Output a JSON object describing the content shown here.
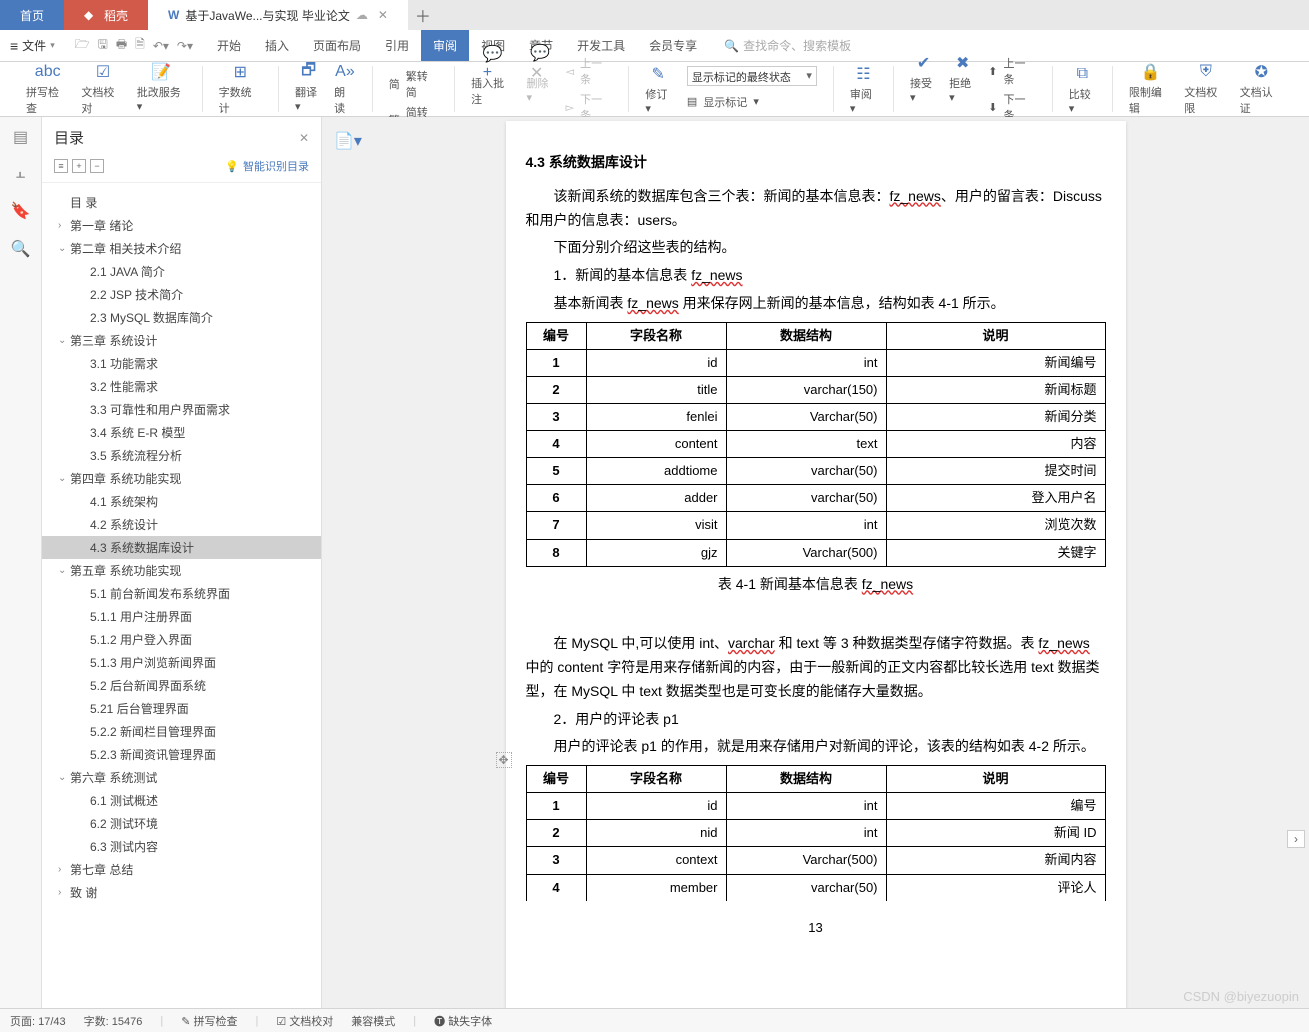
{
  "tabs": {
    "home": "首页",
    "doc": "稻壳",
    "active": "基于JavaWe...与实现 毕业论文"
  },
  "menu": {
    "file": "文件",
    "items": [
      "开始",
      "插入",
      "页面布局",
      "引用",
      "审阅",
      "视图",
      "章节",
      "开发工具",
      "会员专享"
    ],
    "active_index": 4,
    "search_placeholder": "查找命令、搜索模板"
  },
  "ribbon": {
    "spellcheck": "拼写检查",
    "doccheck": "文档校对",
    "revise": "批改服务",
    "wordcount": "字数统计",
    "translate": "翻译",
    "read": "朗读",
    "simp2trad": "繁转简",
    "trad2simp": "简转繁",
    "insert_comment": "插入批注",
    "delete": "删除",
    "prev": "上一条",
    "next": "下一条",
    "revise_track": "修订",
    "markup_select": "显示标记的最终状态",
    "show_markup": "显示标记",
    "review_drop": "审阅",
    "accept": "接受",
    "reject": "拒绝",
    "prev2": "上一条",
    "next2": "下一条",
    "compare": "比较",
    "restrict": "限制编辑",
    "docperm": "文档权限",
    "doccert": "文档认证"
  },
  "toc": {
    "title": "目录",
    "smart": "智能识别目录",
    "items": [
      {
        "t": "目 录",
        "l": 0
      },
      {
        "t": "第一章  绪论",
        "l": 1
      },
      {
        "t": "第二章  相关技术介绍",
        "l": 1,
        "e": true
      },
      {
        "t": "2.1 JAVA 简介",
        "l": 2
      },
      {
        "t": "2.2 JSP 技术简介",
        "l": 2
      },
      {
        "t": "2.3 MySQL 数据库简介",
        "l": 2
      },
      {
        "t": "第三章  系统设计",
        "l": 1,
        "e": true
      },
      {
        "t": "3.1 功能需求",
        "l": 2
      },
      {
        "t": "3.2 性能需求",
        "l": 2
      },
      {
        "t": "3.3 可靠性和用户界面需求",
        "l": 2
      },
      {
        "t": "3.4 系统 E-R 模型",
        "l": 2
      },
      {
        "t": "3.5 系统流程分析",
        "l": 2
      },
      {
        "t": "第四章  系统功能实现",
        "l": 1,
        "e": true
      },
      {
        "t": "4.1 系统架构",
        "l": 2
      },
      {
        "t": "4.2 系统设计",
        "l": 2
      },
      {
        "t": "4.3 系统数据库设计",
        "l": 2,
        "a": true
      },
      {
        "t": "第五章  系统功能实现",
        "l": 1,
        "e": true
      },
      {
        "t": "5.1 前台新闻发布系统界面",
        "l": 2
      },
      {
        "t": "5.1.1 用户注册界面",
        "l": 2
      },
      {
        "t": "5.1.2 用户登入界面",
        "l": 2
      },
      {
        "t": "5.1.3 用户浏览新闻界面",
        "l": 2
      },
      {
        "t": "5.2 后台新闻界面系统",
        "l": 2
      },
      {
        "t": "5.21 后台管理界面",
        "l": 2
      },
      {
        "t": "5.2.2 新闻栏目管理界面",
        "l": 2
      },
      {
        "t": "5.2.3 新闻资讯管理界面",
        "l": 2
      },
      {
        "t": "第六章  系统测试",
        "l": 1,
        "e": true
      },
      {
        "t": "6.1 测试概述",
        "l": 2
      },
      {
        "t": "6.2 测试环境",
        "l": 2
      },
      {
        "t": "6.3 测试内容",
        "l": 2
      },
      {
        "t": "第七章  总结",
        "l": 1
      },
      {
        "t": "致 谢",
        "l": 1
      }
    ]
  },
  "doc": {
    "heading": "4.3 系统数据库设计",
    "p1a": "该新闻系统的数据库包含三个表：新闻的基本信息表：",
    "fz_news": "fz_news",
    "p1b": "、用户的留言表：Discuss 和用户的信息表：users。",
    "p2": "下面分别介绍这些表的结构。",
    "p3a": "1．新闻的基本信息表 ",
    "p4a": "基本新闻表 ",
    "p4b": " 用来保存网上新闻的基本信息，结构如表 4-1 所示。",
    "table1": {
      "headers": [
        "编号",
        "字段名称",
        "数据结构",
        "说明"
      ],
      "rows": [
        [
          "1",
          "id",
          "int",
          "新闻编号"
        ],
        [
          "2",
          "title",
          "varchar(150)",
          "新闻标题"
        ],
        [
          "3",
          "fenlei",
          "Varchar(50)",
          "新闻分类"
        ],
        [
          "4",
          "content",
          "text",
          "内容"
        ],
        [
          "5",
          "addtiome",
          "varchar(50)",
          "提交时间"
        ],
        [
          "6",
          "adder",
          "varchar(50)",
          "登入用户名"
        ],
        [
          "7",
          "visit",
          "int",
          "浏览次数"
        ],
        [
          "8",
          "gjz",
          "Varchar(500)",
          "关键字"
        ]
      ]
    },
    "caption1a": "表 4-1 新闻基本信息表 ",
    "p5a": "在 MySQL 中,可以使用 int、",
    "varchar": "varchar",
    "p5b": " 和 text 等 3 种数据类型存储字符数据。表 ",
    "p5c": " 中的 content 字符是用来存储新闻的内容，由于一般新闻的正文内容都比较长选用 text 数据类型，在 MySQL 中 text 数据类型也是可变长度的能储存大量数据。",
    "p6": "2．用户的评论表 p1",
    "p7": "用户的评论表 p1 的作用，就是用来存储用户对新闻的评论，该表的结构如表 4-2 所示。",
    "table2": {
      "headers": [
        "编号",
        "字段名称",
        "数据结构",
        "说明"
      ],
      "rows": [
        [
          "1",
          "id",
          "int",
          "编号"
        ],
        [
          "2",
          "nid",
          "int",
          "新闻 ID"
        ],
        [
          "3",
          "context",
          "Varchar(500)",
          "新闻内容"
        ],
        [
          "4",
          "member",
          "varchar(50)",
          "评论人"
        ]
      ]
    },
    "page_num": "13"
  },
  "status": {
    "page": "页面: 17/43",
    "words": "字数: 15476",
    "spell": "拼写检查",
    "proof": "文档校对",
    "compat": "兼容模式",
    "missing_font": "缺失字体"
  },
  "watermark": "CSDN @biyezuopin"
}
